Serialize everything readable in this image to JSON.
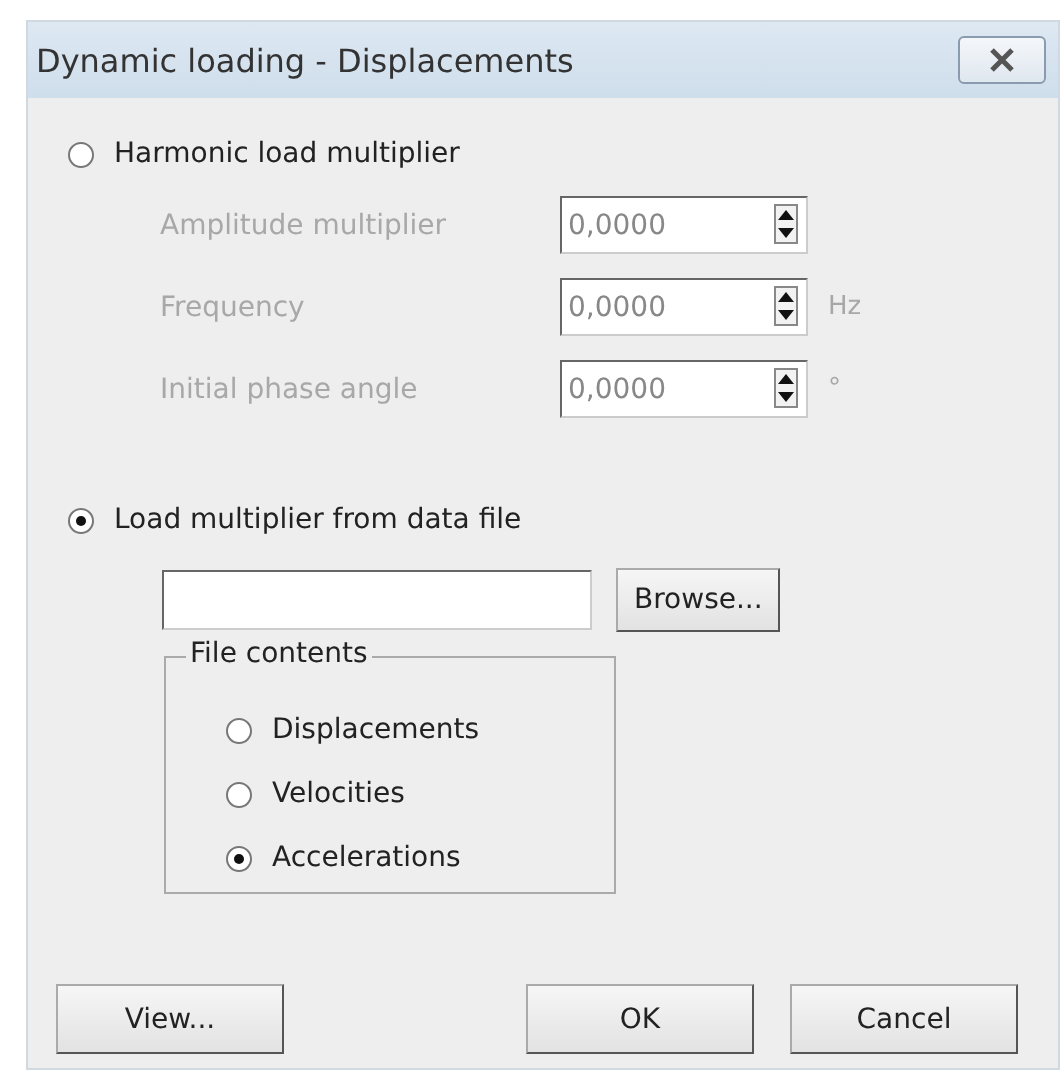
{
  "window": {
    "title": "Dynamic loading - Displacements"
  },
  "harmonic": {
    "label": "Harmonic load multiplier",
    "selected": false,
    "fields": [
      {
        "label": "Amplitude multiplier",
        "value": "0,0000",
        "disabled": true
      },
      {
        "label": "Frequency",
        "value": "0,0000",
        "unit": "Hz",
        "disabled": true
      },
      {
        "label": "Initial phase angle",
        "value": "0,0000",
        "unit": "°",
        "disabled": true
      }
    ]
  },
  "file": {
    "label": "Load multiplier from data file",
    "selected": true,
    "browse": "Browse...",
    "group": {
      "title": "File contents",
      "options": [
        {
          "label": "Displacements",
          "selected": false
        },
        {
          "label": "Velocities",
          "selected": false
        },
        {
          "label": "Accelerations",
          "selected": true
        }
      ]
    }
  },
  "buttons": {
    "view": "View...",
    "ok": "OK",
    "cancel": "Cancel"
  }
}
